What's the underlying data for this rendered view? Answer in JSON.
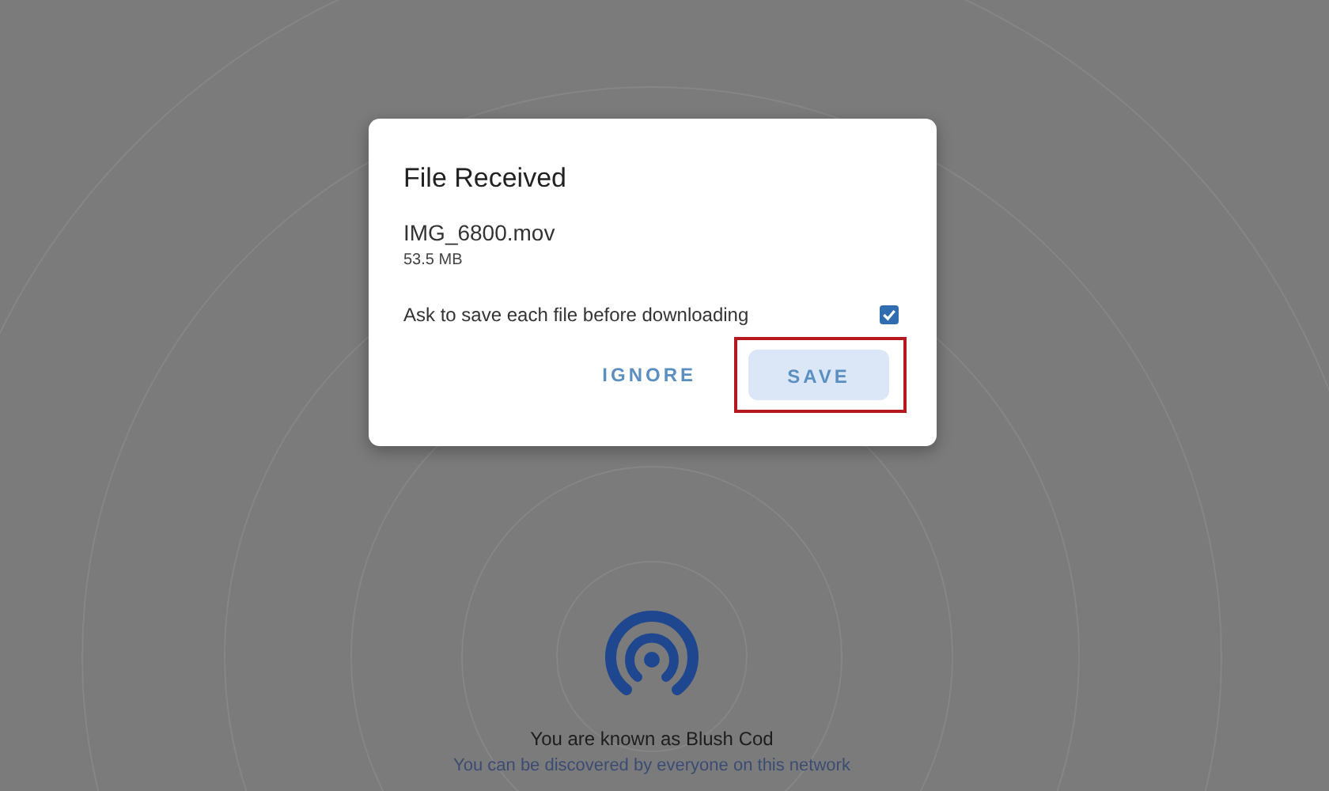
{
  "dialog": {
    "title": "File Received",
    "file_name": "IMG_6800.mov",
    "file_size": "53.5 MB",
    "option": {
      "label": "Ask to save each file before downloading",
      "checked": true
    },
    "buttons": [
      {
        "label": "IGNORE",
        "kind": "text",
        "highlighted": false
      },
      {
        "label": "SAVE",
        "kind": "tonal",
        "highlighted": true
      }
    ]
  },
  "footer": {
    "name_line": "You are known as Blush Cod",
    "discovery_line": "You can be discovered by everyone on this network"
  }
}
